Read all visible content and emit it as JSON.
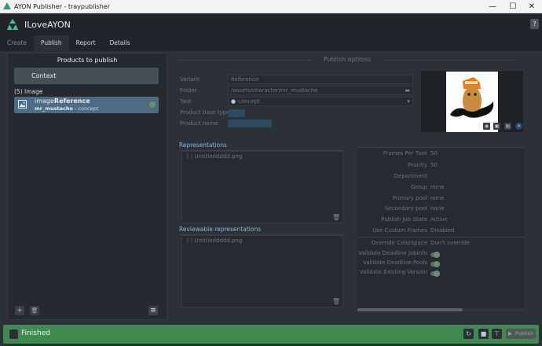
{
  "window": {
    "title": "AYON Publisher - traypublisher",
    "minimize": "—",
    "maximize": "☐",
    "close": "✕"
  },
  "header": {
    "project": "ILoveAYON",
    "help": "?"
  },
  "tabs": [
    {
      "label": "Create"
    },
    {
      "label": "Publish"
    },
    {
      "label": "Report"
    },
    {
      "label": "Details"
    }
  ],
  "products_panel": {
    "title": "Products to publish",
    "context_label": "Context",
    "group_label": "(5) Image",
    "product": {
      "type_prefix": "image",
      "name": "Reference",
      "folder": "mr_mustache",
      "separator": " - ",
      "task": "concept",
      "enabled": true
    },
    "add_button": "+",
    "delete_button": "🗑",
    "menu_button": "≡"
  },
  "publish_options": {
    "title": "Publish options",
    "fields": {
      "variant": {
        "label": "Variant",
        "value": "Reference"
      },
      "folder": {
        "label": "Folder",
        "value": "/assets/character/mr_mustache"
      },
      "task": {
        "label": "Task",
        "value": "concept"
      },
      "product_base_type": {
        "label": "Product base type"
      },
      "product_name": {
        "label": "Product name"
      }
    },
    "representations": {
      "title": "Representations",
      "files": [
        "Untitleddddd.png"
      ]
    },
    "reviewable_representations": {
      "title": "Reviewable representations",
      "files": [
        "Untitleddddd.png"
      ]
    },
    "attributes": [
      {
        "key": "Frames Per Task",
        "value": "50"
      },
      {
        "key": "Priority",
        "value": "50"
      },
      {
        "key": "Department",
        "value": ""
      },
      {
        "key": "Group",
        "value": "none"
      },
      {
        "key": "Primary pool",
        "value": "none"
      },
      {
        "key": "Secondary pool",
        "value": "none"
      },
      {
        "key": "Publish Job State",
        "value": "Active"
      },
      {
        "key": "Use Custom Frames",
        "value": "Disabled"
      }
    ],
    "attributes2": [
      {
        "key": "Override Colorspace",
        "value": "Don't override"
      },
      {
        "key": "Validate Deadline JobInfo",
        "value": ""
      },
      {
        "key": "Validate Deadline Pools",
        "value": ""
      },
      {
        "key": "Validate Existing Version",
        "value": ""
      }
    ]
  },
  "footer": {
    "status": "Finished",
    "publish_label": "Publish"
  },
  "colors": {
    "accent": "#4c6c86",
    "success": "#3f8a4f",
    "bg": "#2c3138"
  }
}
